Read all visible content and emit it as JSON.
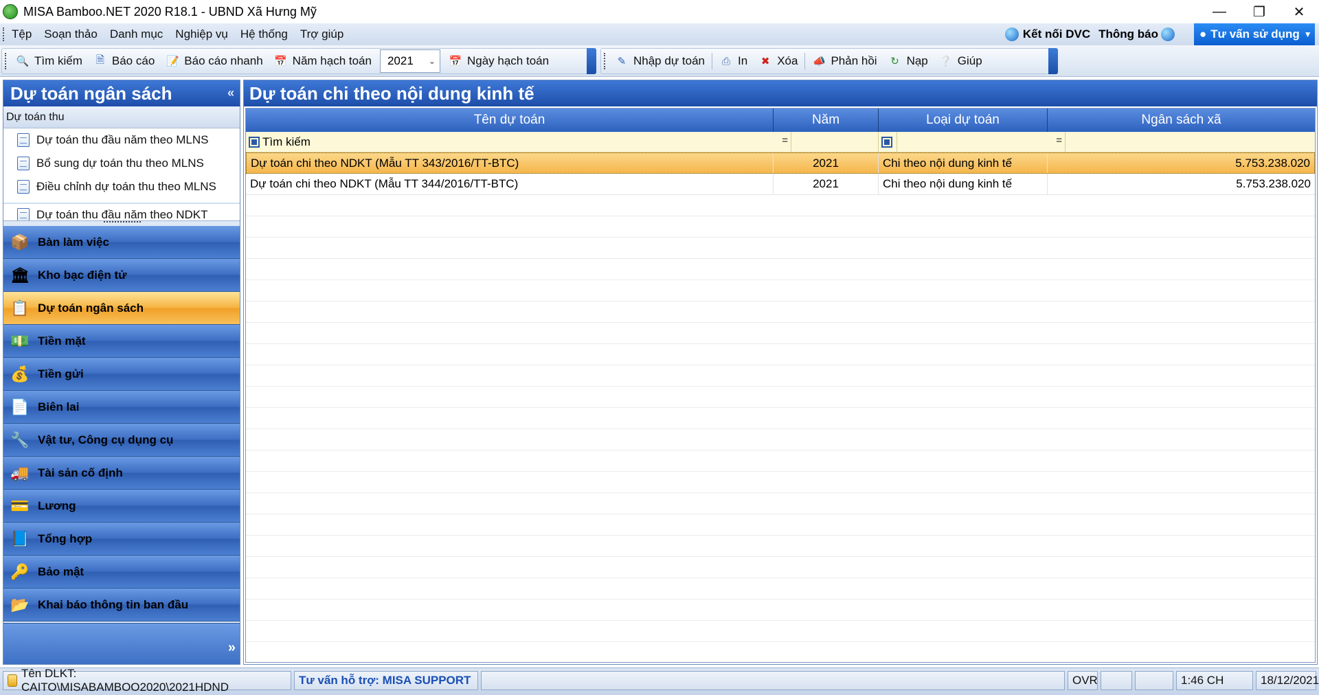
{
  "window": {
    "title": "MISA Bamboo.NET 2020 R18.1 - UBND Xã Hưng Mỹ"
  },
  "menu": {
    "items": [
      "Tệp",
      "Soạn thảo",
      "Danh mục",
      "Nghiệp vụ",
      "Hệ thống",
      "Trợ giúp"
    ],
    "connect_dvc": "Kết nối DVC",
    "notifications": "Thông báo",
    "advise": "Tư vấn sử dụng"
  },
  "toolbar": {
    "search": "Tìm kiếm",
    "report": "Báo cáo",
    "quick_report": "Báo cáo nhanh",
    "fiscal_year_label": "Năm hạch toán",
    "fiscal_year_value": "2021",
    "posting_date": "Ngày hạch toán",
    "enter_budget": "Nhập dự toán",
    "print": "In",
    "delete": "Xóa",
    "feedback": "Phản hồi",
    "reload": "Nạp",
    "help": "Giúp"
  },
  "sidebar": {
    "title": "Dự toán ngân sách",
    "section": "Dự toán thu",
    "tasks": [
      "Dự toán thu đầu năm theo MLNS",
      "Bổ sung dự toán thu theo MLNS",
      "Điều chỉnh dự toán thu theo MLNS",
      "Dự toán thu đầu năm theo NDKT"
    ],
    "nav": [
      {
        "label": "Bàn làm việc",
        "icon": "desk-icon"
      },
      {
        "label": "Kho bạc điện tử",
        "icon": "treasury-icon"
      },
      {
        "label": "Dự toán ngân sách",
        "icon": "budget-icon"
      },
      {
        "label": "Tiền mặt",
        "icon": "cash-icon"
      },
      {
        "label": "Tiền gửi",
        "icon": "deposit-icon"
      },
      {
        "label": "Biên lai",
        "icon": "receipt-icon"
      },
      {
        "label": "Vật tư, Công cụ dụng cụ",
        "icon": "tools-icon"
      },
      {
        "label": "Tài sản cố định",
        "icon": "assets-icon"
      },
      {
        "label": "Lương",
        "icon": "salary-icon"
      },
      {
        "label": "Tổng hợp",
        "icon": "summary-icon"
      },
      {
        "label": "Bảo mật",
        "icon": "security-icon"
      },
      {
        "label": "Khai báo thông tin ban đầu",
        "icon": "setup-icon"
      }
    ],
    "active_index": 2
  },
  "main": {
    "title": "Dự toán chi theo nội dung kinh tế",
    "columns": [
      "Tên dự toán",
      "Năm",
      "Loại dự toán",
      "Ngân sách xã"
    ],
    "filter_placeholder": "Tìm kiếm",
    "rows": [
      [
        "Dự toán chi theo NDKT (Mẫu TT 343/2016/TT-BTC)",
        "2021",
        "Chi theo nội dung kinh tế",
        "5.753.238.020"
      ],
      [
        "Dự toán chi theo NDKT (Mẫu TT 344/2016/TT-BTC)",
        "2021",
        "Chi theo nội dung kinh tế",
        "5.753.238.020"
      ]
    ],
    "selected_row": 0
  },
  "status": {
    "dlkt": "Tên DLKT: CAITO\\MISABAMBOO2020\\2021HDND",
    "support": "Tư vấn hỗ trợ: MISA SUPPORT",
    "ovr": "OVR",
    "time": "1:46 CH",
    "date": "18/12/2021"
  }
}
